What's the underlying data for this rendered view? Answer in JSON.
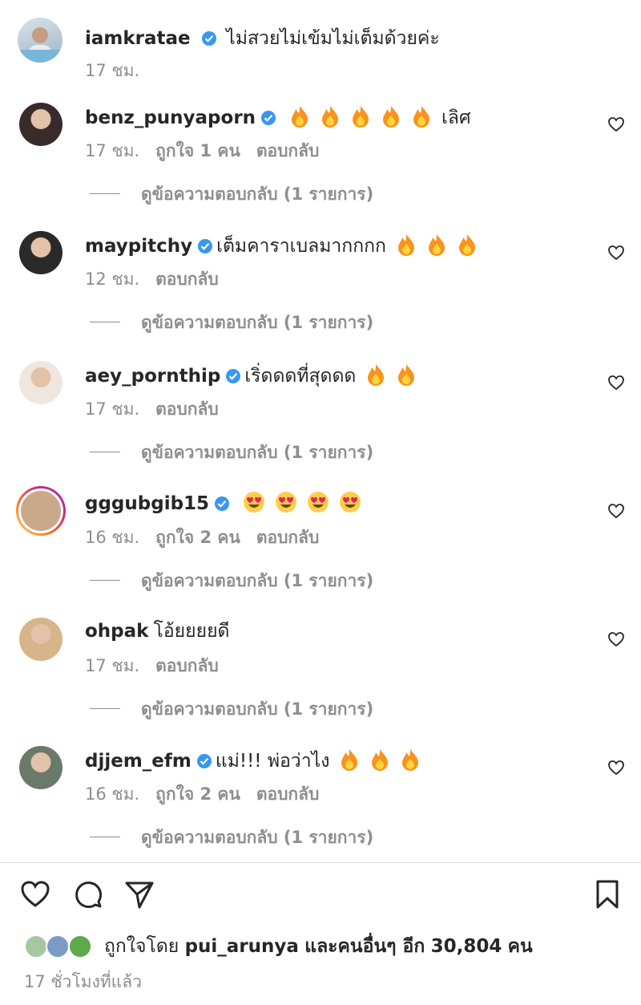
{
  "caption": {
    "username": "iamkratae",
    "text": "ไม่สวยไม่เข้มไม่เต็มด้วยค่ะ",
    "time": "17 ชม."
  },
  "comments": [
    {
      "username": "benz_punyaporn",
      "verified": true,
      "text": "เลิศ",
      "emoji": "fire",
      "emoji_count": 5,
      "emoji_before_text": true,
      "time": "17 ชม.",
      "likes": "ถูกใจ 1 คน",
      "reply": "ตอบกลับ",
      "view_replies": "ดูข้อความตอบกลับ (1 รายการ)"
    },
    {
      "username": "maypitchy",
      "verified": true,
      "text": "เต็มคาราเบลมากกกก",
      "emoji": "fire",
      "emoji_count": 3,
      "emoji_before_text": false,
      "time": "12 ชม.",
      "likes": "",
      "reply": "ตอบกลับ",
      "view_replies": "ดูข้อความตอบกลับ (1 รายการ)"
    },
    {
      "username": "aey_pornthip",
      "verified": true,
      "text": "เริ่ดดดที่สุดดด",
      "emoji": "fire",
      "emoji_count": 2,
      "emoji_before_text": false,
      "time": "17 ชม.",
      "likes": "",
      "reply": "ตอบกลับ",
      "view_replies": "ดูข้อความตอบกลับ (1 รายการ)"
    },
    {
      "username": "gggubgib15",
      "verified": true,
      "text": "",
      "emoji": "heart-eyes",
      "emoji_count": 4,
      "emoji_before_text": true,
      "time": "16 ชม.",
      "likes": "ถูกใจ 2 คน",
      "reply": "ตอบกลับ",
      "view_replies": "ดูข้อความตอบกลับ (1 รายการ)",
      "story_ring": true
    },
    {
      "username": "ohpak",
      "verified": false,
      "text": "โอ้ยยยยดี",
      "emoji": "",
      "emoji_count": 0,
      "emoji_before_text": false,
      "time": "17 ชม.",
      "likes": "",
      "reply": "ตอบกลับ",
      "view_replies": "ดูข้อความตอบกลับ (1 รายการ)"
    },
    {
      "username": "djjem_efm",
      "verified": true,
      "text": "แม่!!! พ่อว่าไง",
      "emoji": "fire",
      "emoji_count": 3,
      "emoji_before_text": false,
      "time": "16 ชม.",
      "likes": "ถูกใจ 2 คน",
      "reply": "ตอบกลับ",
      "view_replies": "ดูข้อความตอบกลับ (1 รายการ)"
    }
  ],
  "actions": {
    "like": "heart-outline-icon",
    "comment": "comment-bubble-icon",
    "share": "paper-plane-icon",
    "save": "bookmark-icon"
  },
  "likes_line": {
    "prefix": "ถูกใจโดย",
    "user": "pui_arunya",
    "middle": "และคนอื่นๆ อีก",
    "count": "30,804",
    "suffix": "คน"
  },
  "post_time": "17 ชั่วโมงที่แล้ว",
  "colors": {
    "text": "#262626",
    "secondary": "#8e8e8e",
    "verified": "#3897f0",
    "fire": "#f7931e",
    "divider": "#dbdbdb"
  }
}
